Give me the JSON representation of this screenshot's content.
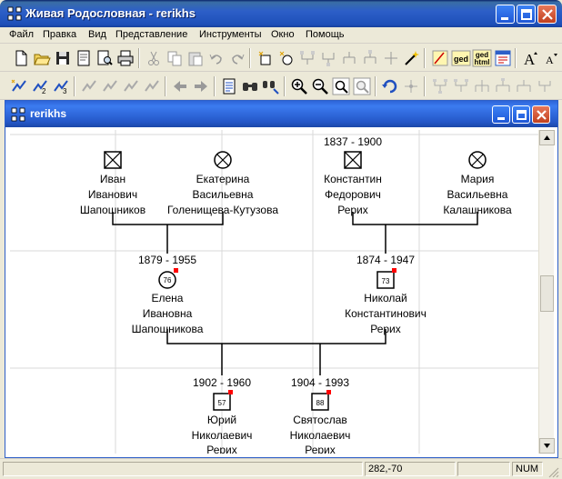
{
  "window": {
    "title": "Живая Родословная - rerikhs"
  },
  "menu": [
    "Файл",
    "Правка",
    "Вид",
    "Представление",
    "Инструменты",
    "Окно",
    "Помощь"
  ],
  "toolbar1": {
    "icons": [
      "new-icon",
      "open-icon",
      "save-icon",
      "page-icon",
      "print-preview-icon",
      "print-icon",
      "cut-icon",
      "copy-icon",
      "paste-icon",
      "undo-icon",
      "redo-icon",
      "add-person-icon",
      "add-relative-icon",
      "tree-tool-1-icon",
      "tree-tool-2-icon",
      "tree-tool-3-icon",
      "tree-tool-4-icon",
      "tree-tool-5-icon",
      "magic-wand-icon",
      "edit-ged-icon",
      "ged-export-icon",
      "ged-html-icon",
      "web-page-icon",
      "font-increase-icon",
      "font-decrease-icon"
    ],
    "ged_label": "ged",
    "ged_html_label": "ged html"
  },
  "toolbar2": {
    "icons": [
      "person-1-icon",
      "person-2-icon",
      "person-3-icon",
      "nav-1-icon",
      "nav-2-icon",
      "nav-3-icon",
      "nav-4-icon",
      "back-icon",
      "forward-icon",
      "document-icon",
      "find-icon",
      "find-next-icon",
      "zoom-in-icon",
      "zoom-out-icon",
      "zoom-fit-icon",
      "zoom-page-icon",
      "refresh-icon",
      "center-icon",
      "layout-1-icon",
      "layout-2-icon",
      "layout-3-icon",
      "layout-4-icon",
      "layout-5-icon",
      "layout-6-icon"
    ]
  },
  "document": {
    "title": "rerikhs"
  },
  "tree": {
    "persons": [
      {
        "id": "ivan",
        "gender": "male",
        "dates": "",
        "name": [
          "Иван",
          "Иванович",
          "Шапошников"
        ]
      },
      {
        "id": "ekaterina",
        "gender": "female",
        "dates": "",
        "name": [
          "Екатерина",
          "Васильевна",
          "Голенищева-Кутузова"
        ]
      },
      {
        "id": "konstantin",
        "gender": "male",
        "dates": "1837 - 1900",
        "name": [
          "Константин",
          "Федорович",
          "Рерих"
        ]
      },
      {
        "id": "maria",
        "gender": "female",
        "dates": "",
        "name": [
          "Мария",
          "Васильевна",
          "Калашникова"
        ]
      },
      {
        "id": "elena",
        "gender": "female",
        "dates": "1879 - 1955",
        "age": "76",
        "name": [
          "Елена",
          "Ивановна",
          "Шапошникова"
        ]
      },
      {
        "id": "nikolai",
        "gender": "male",
        "dates": "1874 - 1947",
        "age": "73",
        "name": [
          "Николай",
          "Константинович",
          "Рерих"
        ]
      },
      {
        "id": "yuri",
        "gender": "male",
        "dates": "1902 - 1960",
        "age": "57",
        "name": [
          "Юрий",
          "Николаевич",
          "Рерих"
        ]
      },
      {
        "id": "svyatoslav",
        "gender": "male",
        "dates": "1904 - 1993",
        "age": "88",
        "name": [
          "Святослав",
          "Николаевич",
          "Рерих"
        ]
      }
    ]
  },
  "status": {
    "coords": "282,-70",
    "num": "NUM"
  },
  "colors": {
    "marker": "#FF0000",
    "title_blue": "#2D5FC8"
  }
}
